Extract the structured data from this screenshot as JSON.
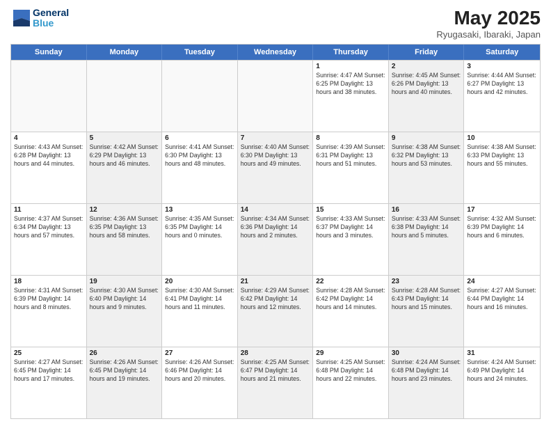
{
  "header": {
    "logo": {
      "line1": "General",
      "line2": "Blue"
    },
    "title": "May 2025",
    "location": "Ryugasaki, Ibaraki, Japan"
  },
  "weekdays": [
    "Sunday",
    "Monday",
    "Tuesday",
    "Wednesday",
    "Thursday",
    "Friday",
    "Saturday"
  ],
  "weeks": [
    [
      {
        "day": "",
        "info": "",
        "shaded": false,
        "empty": true
      },
      {
        "day": "",
        "info": "",
        "shaded": false,
        "empty": true
      },
      {
        "day": "",
        "info": "",
        "shaded": false,
        "empty": true
      },
      {
        "day": "",
        "info": "",
        "shaded": false,
        "empty": true
      },
      {
        "day": "1",
        "info": "Sunrise: 4:47 AM\nSunset: 6:25 PM\nDaylight: 13 hours\nand 38 minutes.",
        "shaded": false,
        "empty": false
      },
      {
        "day": "2",
        "info": "Sunrise: 4:45 AM\nSunset: 6:26 PM\nDaylight: 13 hours\nand 40 minutes.",
        "shaded": true,
        "empty": false
      },
      {
        "day": "3",
        "info": "Sunrise: 4:44 AM\nSunset: 6:27 PM\nDaylight: 13 hours\nand 42 minutes.",
        "shaded": false,
        "empty": false
      }
    ],
    [
      {
        "day": "4",
        "info": "Sunrise: 4:43 AM\nSunset: 6:28 PM\nDaylight: 13 hours\nand 44 minutes.",
        "shaded": false,
        "empty": false
      },
      {
        "day": "5",
        "info": "Sunrise: 4:42 AM\nSunset: 6:29 PM\nDaylight: 13 hours\nand 46 minutes.",
        "shaded": true,
        "empty": false
      },
      {
        "day": "6",
        "info": "Sunrise: 4:41 AM\nSunset: 6:30 PM\nDaylight: 13 hours\nand 48 minutes.",
        "shaded": false,
        "empty": false
      },
      {
        "day": "7",
        "info": "Sunrise: 4:40 AM\nSunset: 6:30 PM\nDaylight: 13 hours\nand 49 minutes.",
        "shaded": true,
        "empty": false
      },
      {
        "day": "8",
        "info": "Sunrise: 4:39 AM\nSunset: 6:31 PM\nDaylight: 13 hours\nand 51 minutes.",
        "shaded": false,
        "empty": false
      },
      {
        "day": "9",
        "info": "Sunrise: 4:38 AM\nSunset: 6:32 PM\nDaylight: 13 hours\nand 53 minutes.",
        "shaded": true,
        "empty": false
      },
      {
        "day": "10",
        "info": "Sunrise: 4:38 AM\nSunset: 6:33 PM\nDaylight: 13 hours\nand 55 minutes.",
        "shaded": false,
        "empty": false
      }
    ],
    [
      {
        "day": "11",
        "info": "Sunrise: 4:37 AM\nSunset: 6:34 PM\nDaylight: 13 hours\nand 57 minutes.",
        "shaded": false,
        "empty": false
      },
      {
        "day": "12",
        "info": "Sunrise: 4:36 AM\nSunset: 6:35 PM\nDaylight: 13 hours\nand 58 minutes.",
        "shaded": true,
        "empty": false
      },
      {
        "day": "13",
        "info": "Sunrise: 4:35 AM\nSunset: 6:35 PM\nDaylight: 14 hours\nand 0 minutes.",
        "shaded": false,
        "empty": false
      },
      {
        "day": "14",
        "info": "Sunrise: 4:34 AM\nSunset: 6:36 PM\nDaylight: 14 hours\nand 2 minutes.",
        "shaded": true,
        "empty": false
      },
      {
        "day": "15",
        "info": "Sunrise: 4:33 AM\nSunset: 6:37 PM\nDaylight: 14 hours\nand 3 minutes.",
        "shaded": false,
        "empty": false
      },
      {
        "day": "16",
        "info": "Sunrise: 4:33 AM\nSunset: 6:38 PM\nDaylight: 14 hours\nand 5 minutes.",
        "shaded": true,
        "empty": false
      },
      {
        "day": "17",
        "info": "Sunrise: 4:32 AM\nSunset: 6:39 PM\nDaylight: 14 hours\nand 6 minutes.",
        "shaded": false,
        "empty": false
      }
    ],
    [
      {
        "day": "18",
        "info": "Sunrise: 4:31 AM\nSunset: 6:39 PM\nDaylight: 14 hours\nand 8 minutes.",
        "shaded": false,
        "empty": false
      },
      {
        "day": "19",
        "info": "Sunrise: 4:30 AM\nSunset: 6:40 PM\nDaylight: 14 hours\nand 9 minutes.",
        "shaded": true,
        "empty": false
      },
      {
        "day": "20",
        "info": "Sunrise: 4:30 AM\nSunset: 6:41 PM\nDaylight: 14 hours\nand 11 minutes.",
        "shaded": false,
        "empty": false
      },
      {
        "day": "21",
        "info": "Sunrise: 4:29 AM\nSunset: 6:42 PM\nDaylight: 14 hours\nand 12 minutes.",
        "shaded": true,
        "empty": false
      },
      {
        "day": "22",
        "info": "Sunrise: 4:28 AM\nSunset: 6:42 PM\nDaylight: 14 hours\nand 14 minutes.",
        "shaded": false,
        "empty": false
      },
      {
        "day": "23",
        "info": "Sunrise: 4:28 AM\nSunset: 6:43 PM\nDaylight: 14 hours\nand 15 minutes.",
        "shaded": true,
        "empty": false
      },
      {
        "day": "24",
        "info": "Sunrise: 4:27 AM\nSunset: 6:44 PM\nDaylight: 14 hours\nand 16 minutes.",
        "shaded": false,
        "empty": false
      }
    ],
    [
      {
        "day": "25",
        "info": "Sunrise: 4:27 AM\nSunset: 6:45 PM\nDaylight: 14 hours\nand 17 minutes.",
        "shaded": false,
        "empty": false
      },
      {
        "day": "26",
        "info": "Sunrise: 4:26 AM\nSunset: 6:45 PM\nDaylight: 14 hours\nand 19 minutes.",
        "shaded": true,
        "empty": false
      },
      {
        "day": "27",
        "info": "Sunrise: 4:26 AM\nSunset: 6:46 PM\nDaylight: 14 hours\nand 20 minutes.",
        "shaded": false,
        "empty": false
      },
      {
        "day": "28",
        "info": "Sunrise: 4:25 AM\nSunset: 6:47 PM\nDaylight: 14 hours\nand 21 minutes.",
        "shaded": true,
        "empty": false
      },
      {
        "day": "29",
        "info": "Sunrise: 4:25 AM\nSunset: 6:48 PM\nDaylight: 14 hours\nand 22 minutes.",
        "shaded": false,
        "empty": false
      },
      {
        "day": "30",
        "info": "Sunrise: 4:24 AM\nSunset: 6:48 PM\nDaylight: 14 hours\nand 23 minutes.",
        "shaded": true,
        "empty": false
      },
      {
        "day": "31",
        "info": "Sunrise: 4:24 AM\nSunset: 6:49 PM\nDaylight: 14 hours\nand 24 minutes.",
        "shaded": false,
        "empty": false
      }
    ]
  ]
}
